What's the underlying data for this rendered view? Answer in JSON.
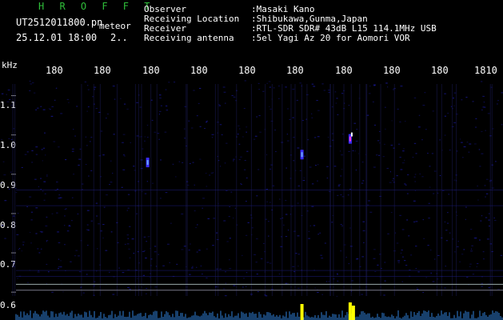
{
  "header": {
    "logo_text": "H R O F F T",
    "filename": "UT2512011800.pn",
    "type": "meteor",
    "datetime": "25.12.01 18:00",
    "count": "2..",
    "info": [
      {
        "label": "Observer",
        "value": ":Masaki Kano"
      },
      {
        "label": "Receiving Location",
        "value": ":Shibukawa,Gunma,Japan"
      },
      {
        "label": "Receiver",
        "value": ":RTL-SDR SDR# 43dB L15 114.1MHz USB"
      },
      {
        "label": "Receiving antenna",
        "value": ":5el Yagi Az 20 for Aomori VOR"
      }
    ]
  },
  "chart_data": {
    "type": "heatmap",
    "ylabel": "kHz",
    "x_ticks": [
      "180",
      "180",
      "180",
      "180",
      "180",
      "180",
      "180",
      "180",
      "180",
      "1810"
    ],
    "y_ticks": [
      "1.1",
      "1.0",
      "0.9",
      "0.8",
      "0.7",
      "0.6"
    ],
    "ylim": [
      0.58,
      1.15
    ],
    "signals": [
      {
        "time_min": 6.3,
        "freq_khz": 0.99
      },
      {
        "time_min": 5.3,
        "freq_khz": 0.95
      },
      {
        "time_min": 2.1,
        "freq_khz": 0.93
      }
    ]
  },
  "colors": {
    "background": "#000000",
    "logo": "#2fbf3a",
    "noise": "#1a1aa0",
    "signal_hot": "#ffff00"
  }
}
